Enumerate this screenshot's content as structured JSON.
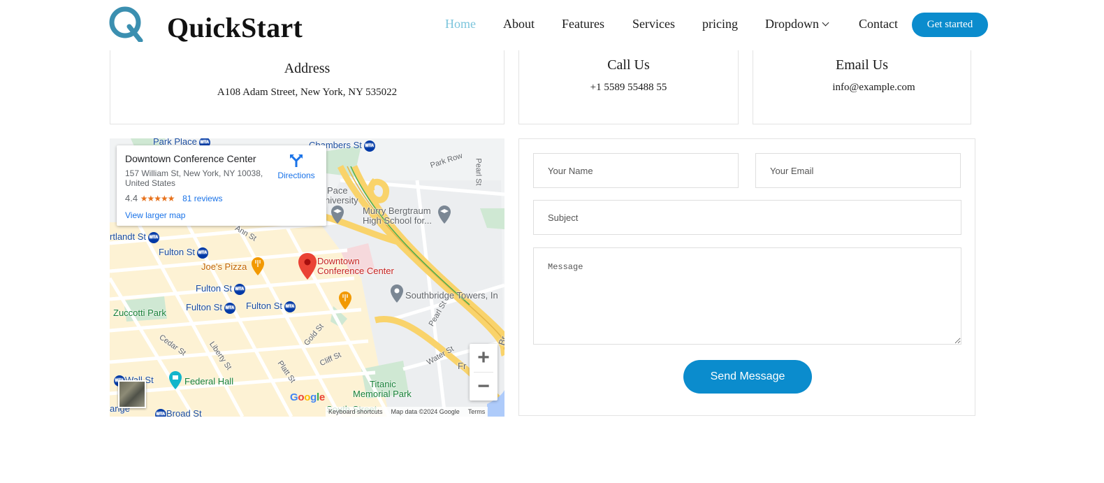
{
  "brand": {
    "name": "QuickStart",
    "accent": "#0b8ccd",
    "logo_ring": "#3b8fb0"
  },
  "nav": {
    "items": [
      {
        "label": "Home",
        "active": true
      },
      {
        "label": "About"
      },
      {
        "label": "Features"
      },
      {
        "label": "Services"
      },
      {
        "label": "pricing"
      },
      {
        "label": "Dropdown",
        "icon": "chevron-down-icon"
      },
      {
        "label": "Contact"
      }
    ],
    "cta": "Get started"
  },
  "info": {
    "address": {
      "title": "Address",
      "value": "A108 Adam Street, New York, NY 535022"
    },
    "call": {
      "title": "Call Us",
      "value": "+1 5589 55488 55"
    },
    "email": {
      "title": "Email Us",
      "value": "info@example.com"
    }
  },
  "map": {
    "card": {
      "title": "Downtown Conference Center",
      "address": "157 William St, New York, NY 10038, United States",
      "rating": "4.4",
      "stars": "★★★★★",
      "reviews": "81 reviews",
      "larger_map": "View larger map",
      "directions": "Directions"
    },
    "labels": {
      "park_place": "Park Place",
      "chambers": "Chambers St",
      "park_row": "Park Row",
      "pearl_st_top": "Pearl St",
      "pace": "Pace",
      "university": "niversity",
      "murry_1": "Murry Bergtraum",
      "murry_2": "High School for...",
      "cortlandt": "rtlandt St",
      "fulton_1": "Fulton St",
      "fulton_2": "Fulton St",
      "fulton_3": "Fulton St",
      "fulton_4": "Fulton St",
      "ann_st": "Ann St",
      "joes": "Joe's Pizza",
      "pin_1": "Downtown",
      "pin_2": "Conference Center",
      "southbridge": "Southbridge Towers, In",
      "zuccotti": "Zuccotti Park",
      "pearl_st": "Pearl St",
      "cedar": "Cedar St",
      "liberty": "Liberty St",
      "gold": "Gold St",
      "cliff": "Cliff St",
      "platt": "Platt St",
      "water": "Water St",
      "wall": "Wall St",
      "federal": "Federal Hall",
      "titanic_1": "Titanic",
      "titanic_2": "Memorial Park",
      "broad": "Broad St",
      "south_st": "South Street",
      "exchange": "ange",
      "fr": "Fr",
      "br": "Br",
      "mta": "MTA"
    },
    "zoom_in": "+",
    "zoom_out": "−",
    "google": [
      "G",
      "o",
      "o",
      "g",
      "l",
      "e"
    ],
    "attribution": [
      "Keyboard shortcuts",
      "Map data ©2024 Google",
      "Terms"
    ]
  },
  "form": {
    "name_placeholder": "Your Name",
    "email_placeholder": "Your Email",
    "subject_placeholder": "Subject",
    "message_placeholder": "Message",
    "submit": "Send Message"
  }
}
